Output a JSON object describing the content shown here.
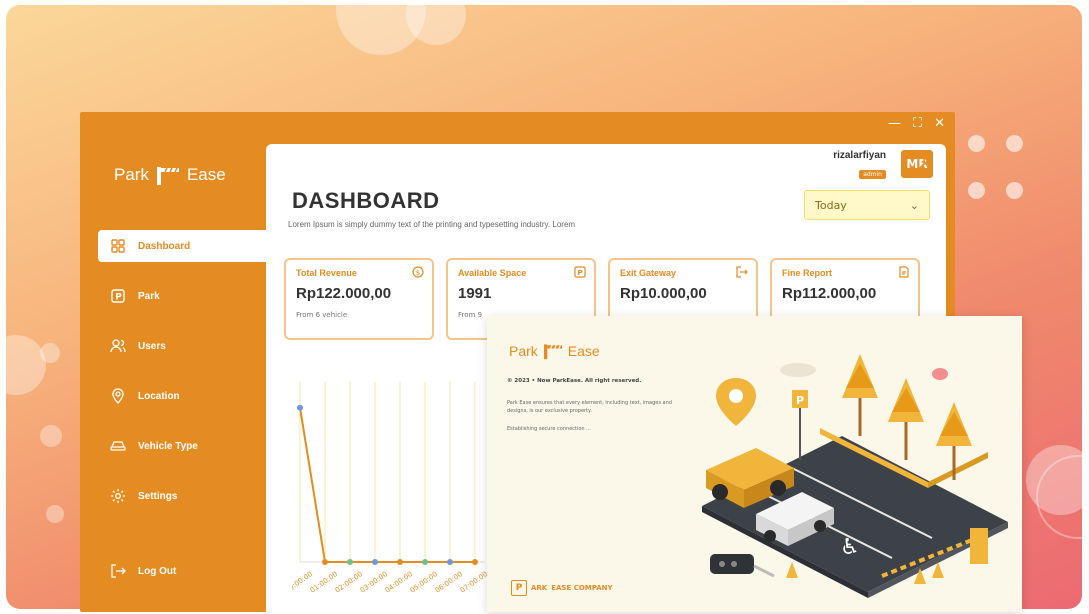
{
  "app": {
    "logo_left": "Park",
    "logo_right": "Ease",
    "window_controls": [
      "—",
      "⛶",
      "✕"
    ]
  },
  "nav": {
    "items": [
      {
        "label": "Dashboard",
        "icon": "grid-icon",
        "active": true
      },
      {
        "label": "Park",
        "icon": "parking-icon",
        "active": false
      },
      {
        "label": "Users",
        "icon": "users-icon",
        "active": false
      },
      {
        "label": "Location",
        "icon": "location-pin-icon",
        "active": false
      },
      {
        "label": "Vehicle Type",
        "icon": "car-icon",
        "active": false
      },
      {
        "label": "Settings",
        "icon": "gear-icon",
        "active": false
      }
    ],
    "logout": "Log Out"
  },
  "user": {
    "name": "rizalarfiyan",
    "role": "admin",
    "initials": "MR"
  },
  "header": {
    "title": "DASHBOARD",
    "subtitle": "Lorem Ipsum is simply dummy text of the printing and typesetting industry. Lorem",
    "period": "Today"
  },
  "cards": [
    {
      "label": "Total Revenue",
      "value": "Rp122.000,00",
      "note": "From 6 vehicle",
      "icon": "coin-icon"
    },
    {
      "label": "Available Space",
      "value": "1991",
      "note": "From 9",
      "icon": "parking-icon"
    },
    {
      "label": "Exit Gateway",
      "value": "Rp10.000,00",
      "note": "",
      "icon": "exit-icon"
    },
    {
      "label": "Fine Report",
      "value": "Rp112.000,00",
      "note": "",
      "icon": "report-icon"
    }
  ],
  "chart_data": {
    "type": "line",
    "x": [
      "00:00:00",
      "01:00:00",
      "02:00:00",
      "03:00:00",
      "04:00:00",
      "05:00:00",
      "06:00:00",
      "07:00:00"
    ],
    "series": [
      {
        "values": [
          6,
          0,
          0,
          0,
          0,
          0,
          0,
          0
        ],
        "color": "#e48c22"
      }
    ],
    "ylim": [
      0,
      7
    ],
    "grid": true
  },
  "splash": {
    "logo_left": "Park",
    "logo_right": "Ease",
    "copyright": "© 2023 • Now ParkEase. All right reserved.",
    "description": "Park Ease ensures that every element, including text, images and designs, is our exclusive property.",
    "status": "Establishing secure connection ...",
    "footer_prefix": "ARK",
    "footer_company": "EASE COMPANY"
  },
  "colors": {
    "accent": "#e48c22",
    "card_border": "#f3c58a",
    "period_bg": "#fff8c8"
  }
}
